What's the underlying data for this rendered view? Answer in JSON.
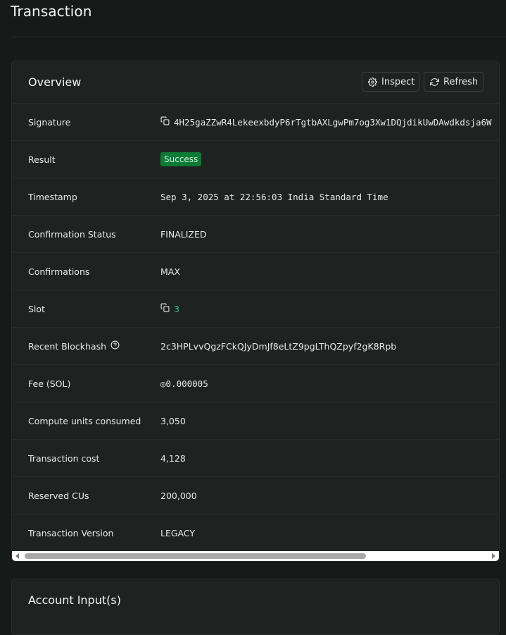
{
  "page": {
    "title": "Transaction"
  },
  "overview": {
    "title": "Overview",
    "inspect_label": "Inspect",
    "refresh_label": "Refresh",
    "rows": {
      "signature": {
        "label": "Signature",
        "value": "4H25gaZZwR4LekeexbdyP6rTgtbAXLgwPm7og3Xw1DQjdikUwDAwdkdsja6W"
      },
      "result": {
        "label": "Result",
        "value": "Success"
      },
      "timestamp": {
        "label": "Timestamp",
        "value": "Sep 3, 2025 at 22:56:03 India Standard Time"
      },
      "confirmation_status": {
        "label": "Confirmation Status",
        "value": "FINALIZED"
      },
      "confirmations": {
        "label": "Confirmations",
        "value": "MAX"
      },
      "slot": {
        "label": "Slot",
        "value": "3"
      },
      "recent_blockhash": {
        "label": "Recent Blockhash",
        "value": "2c3HPLvvQgzFCkQJyDmJf8eLtZ9pgLThQZpyf2gK8Rpb"
      },
      "fee": {
        "label": "Fee (SOL)",
        "value": "◎0.000005"
      },
      "compute_units": {
        "label": "Compute units consumed",
        "value": "3,050"
      },
      "transaction_cost": {
        "label": "Transaction cost",
        "value": "4,128"
      },
      "reserved_cus": {
        "label": "Reserved CUs",
        "value": "200,000"
      },
      "transaction_version": {
        "label": "Transaction Version",
        "value": "LEGACY"
      }
    }
  },
  "accounts": {
    "title": "Account Input(s)"
  },
  "icons": {
    "inspect": "gear-icon",
    "refresh": "refresh-icon",
    "copy": "copy-icon",
    "help": "help-circle-icon"
  },
  "colors": {
    "background": "#161a19",
    "card": "#1e2322",
    "success_badge": "#0d7a36",
    "link": "#35c28c"
  }
}
